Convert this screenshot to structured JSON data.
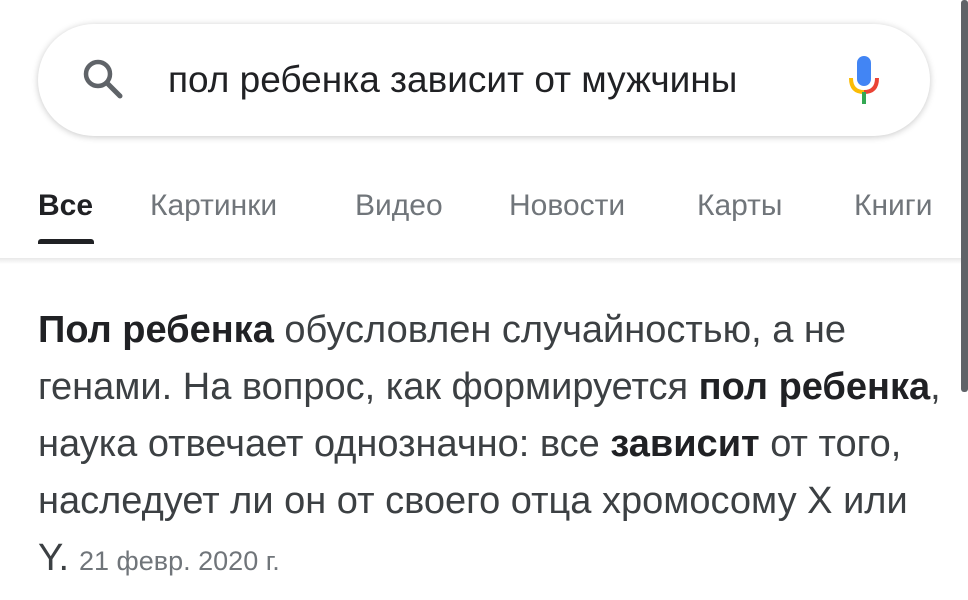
{
  "search": {
    "query": "пол ребенка зависит от мужчины",
    "icons": [
      "search-icon",
      "mic-icon"
    ]
  },
  "tabs": [
    {
      "label": "Все",
      "active": true
    },
    {
      "label": "Картинки",
      "active": false
    },
    {
      "label": "Видео",
      "active": false
    },
    {
      "label": "Новости",
      "active": false
    },
    {
      "label": "Карты",
      "active": false
    },
    {
      "label": "Книги",
      "active": false
    }
  ],
  "snippet": {
    "segments": [
      {
        "text": "Пол ребенка",
        "bold": true
      },
      {
        "text": " обусловлен случайностью, а не генами. На вопрос, как формируется ",
        "bold": false
      },
      {
        "text": "пол ребенка",
        "bold": true
      },
      {
        "text": ", наука отвечает однозначно: все ",
        "bold": false
      },
      {
        "text": "зависит",
        "bold": true
      },
      {
        "text": " от того, наследует ли он от своего отца хромосому X или Y.",
        "bold": false
      }
    ],
    "date": "21 февр. 2020 г."
  },
  "colors": {
    "text_primary": "#202124",
    "text_secondary": "#70757a",
    "mic_blue": "#4285f4",
    "mic_red": "#ea4335",
    "mic_yellow": "#fbbc05",
    "mic_green": "#34a853"
  }
}
